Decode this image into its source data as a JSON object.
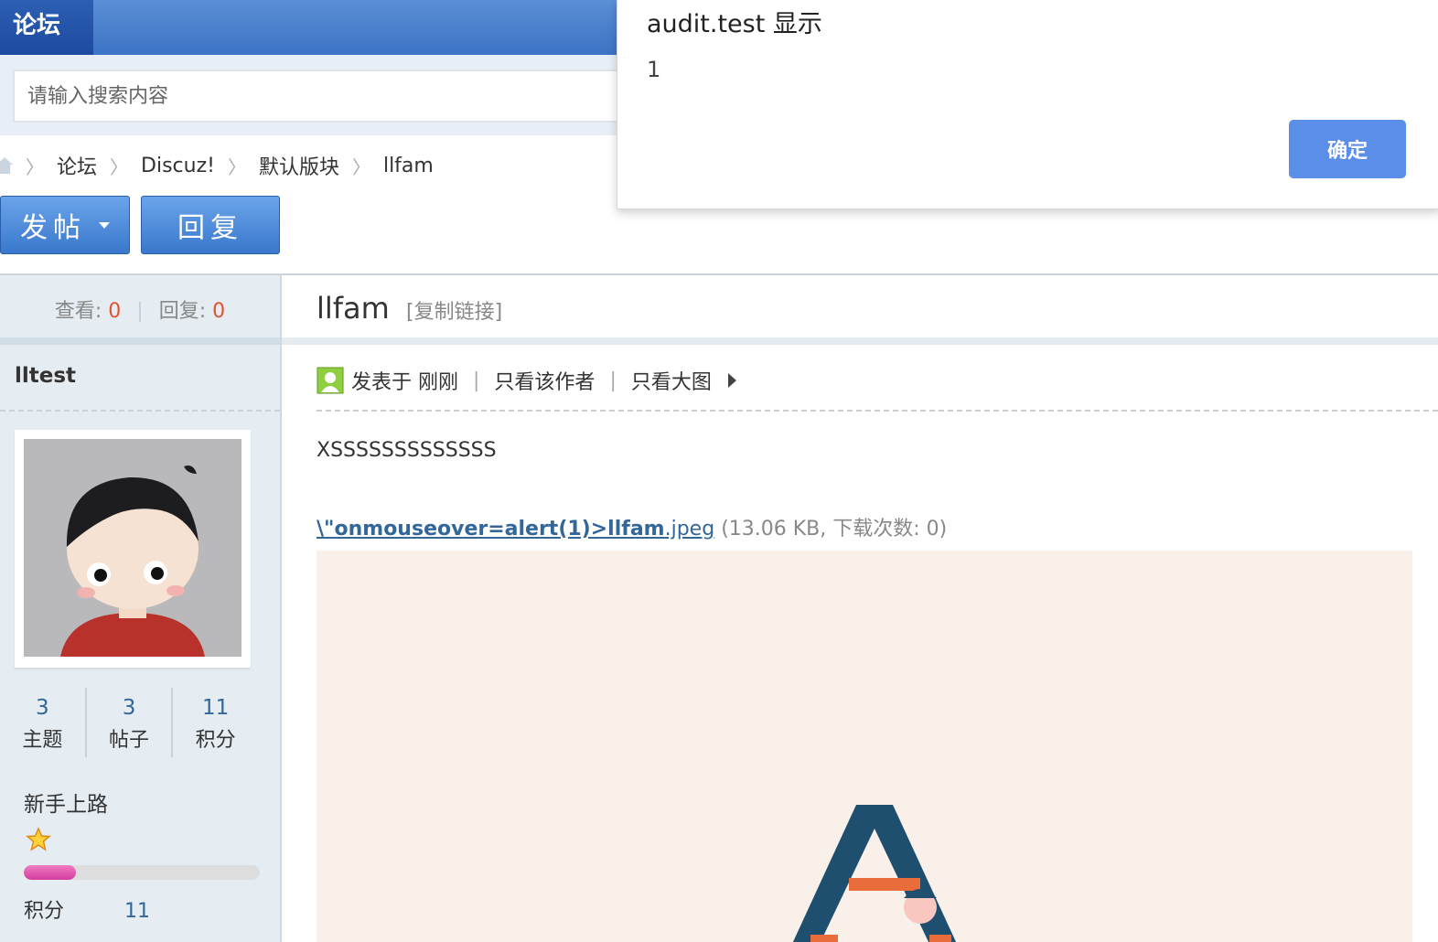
{
  "header": {
    "brand": "论坛"
  },
  "search": {
    "placeholder": "请输入搜索内容"
  },
  "breadcrumb": {
    "items": [
      "论坛",
      "Discuz!",
      "默认版块",
      "llfam"
    ]
  },
  "actions": {
    "post_label": "发帖",
    "reply_label": "回复"
  },
  "thread": {
    "views_label": "查看:",
    "views": "0",
    "replies_label": "回复:",
    "replies": "0",
    "title": "llfam",
    "copy_link": "[复制链接]"
  },
  "author": {
    "username": "lltest",
    "stats": [
      {
        "value": "3",
        "label": "主题"
      },
      {
        "value": "3",
        "label": "帖子"
      },
      {
        "value": "11",
        "label": "积分"
      }
    ],
    "group": "新手上路",
    "progress_fraction": 0.22,
    "credits_label": "积分",
    "credits_value": "11"
  },
  "post": {
    "posted_at": "发表于 刚刚",
    "only_author": "只看该作者",
    "only_images": "只看大图",
    "content": "XSSSSSSSSSSSSS",
    "attachment": {
      "name_bold": "\\\"onmouseover=alert(1)>llfam",
      "ext": ".jpeg",
      "info": "(13.06 KB, 下载次数: 0)"
    }
  },
  "dialog": {
    "title": "audit.test 显示",
    "message": "1",
    "ok_label": "确定"
  },
  "colors": {
    "accent": "#3c73c4",
    "counter": "#e0532c",
    "link": "#336699",
    "dialog_button": "#5b8ee8"
  }
}
